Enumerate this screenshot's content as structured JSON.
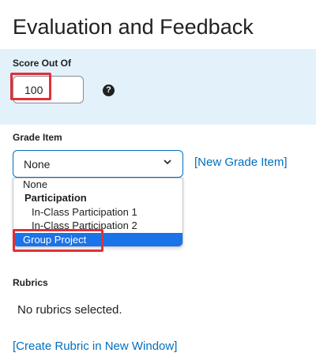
{
  "section_title": "Evaluation and Feedback",
  "score": {
    "label": "Score Out Of",
    "value": "100",
    "help_icon": "question-circle-icon"
  },
  "grade_item": {
    "label": "Grade Item",
    "selected_value": "None",
    "new_link": "[New Grade Item]",
    "options": {
      "none": "None",
      "group": "Participation",
      "item1": "In-Class Participation 1",
      "item2": "In-Class Participation 2",
      "highlighted": "Group Project"
    }
  },
  "rubrics": {
    "label": "Rubrics",
    "empty_text": "No rubrics selected.",
    "create_link": "[Create Rubric in New Window]"
  },
  "colors": {
    "panel_bg": "#e3f1fb",
    "link": "#006fbf",
    "selected_option_bg": "#1a73e8",
    "highlight_box": "#e0303a"
  }
}
